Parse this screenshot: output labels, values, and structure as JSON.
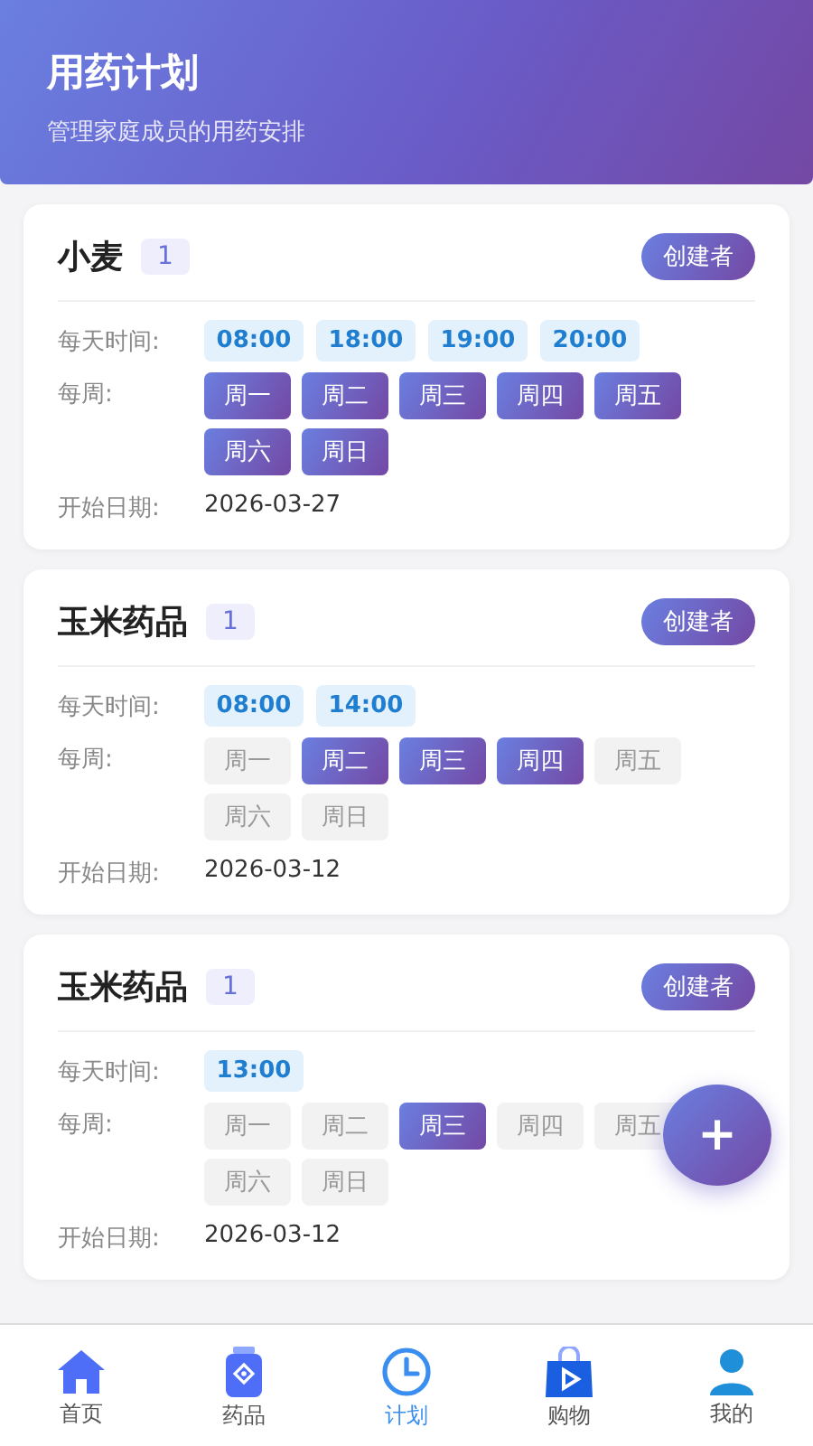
{
  "header": {
    "title": "用药计划",
    "subtitle": "管理家庭成员的用药安排"
  },
  "plans": [
    {
      "name": "小麦",
      "count": "1",
      "role": "创建者",
      "times_label": "每天时间:",
      "times": [
        "08:00",
        "18:00",
        "19:00",
        "20:00"
      ],
      "days_label": "每周:",
      "days": [
        {
          "label": "周一",
          "selected": true
        },
        {
          "label": "周二",
          "selected": true
        },
        {
          "label": "周三",
          "selected": true
        },
        {
          "label": "周四",
          "selected": true
        },
        {
          "label": "周五",
          "selected": true
        },
        {
          "label": "周六",
          "selected": true
        },
        {
          "label": "周日",
          "selected": true
        }
      ],
      "start_label": "开始日期:",
      "start_date": "2026-03-27"
    },
    {
      "name": "玉米药品",
      "count": "1",
      "role": "创建者",
      "times_label": "每天时间:",
      "times": [
        "08:00",
        "14:00"
      ],
      "days_label": "每周:",
      "days": [
        {
          "label": "周一",
          "selected": false
        },
        {
          "label": "周二",
          "selected": true
        },
        {
          "label": "周三",
          "selected": true
        },
        {
          "label": "周四",
          "selected": true
        },
        {
          "label": "周五",
          "selected": false
        },
        {
          "label": "周六",
          "selected": false
        },
        {
          "label": "周日",
          "selected": false
        }
      ],
      "start_label": "开始日期:",
      "start_date": "2026-03-12"
    },
    {
      "name": "玉米药品",
      "count": "1",
      "role": "创建者",
      "times_label": "每天时间:",
      "times": [
        "13:00"
      ],
      "days_label": "每周:",
      "days": [
        {
          "label": "周一",
          "selected": false
        },
        {
          "label": "周二",
          "selected": false
        },
        {
          "label": "周三",
          "selected": true
        },
        {
          "label": "周四",
          "selected": false
        },
        {
          "label": "周五",
          "selected": false
        },
        {
          "label": "周六",
          "selected": false
        },
        {
          "label": "周日",
          "selected": false
        }
      ],
      "start_label": "开始日期:",
      "start_date": "2026-03-12"
    }
  ],
  "fab": {
    "label": "+"
  },
  "tabs": [
    {
      "kind": "home",
      "label": "首页",
      "selected": false
    },
    {
      "kind": "medicine",
      "label": "药品",
      "selected": false
    },
    {
      "kind": "plan",
      "label": "计划",
      "selected": true
    },
    {
      "kind": "shop",
      "label": "购物",
      "selected": false
    },
    {
      "kind": "profile",
      "label": "我的",
      "selected": false
    }
  ]
}
